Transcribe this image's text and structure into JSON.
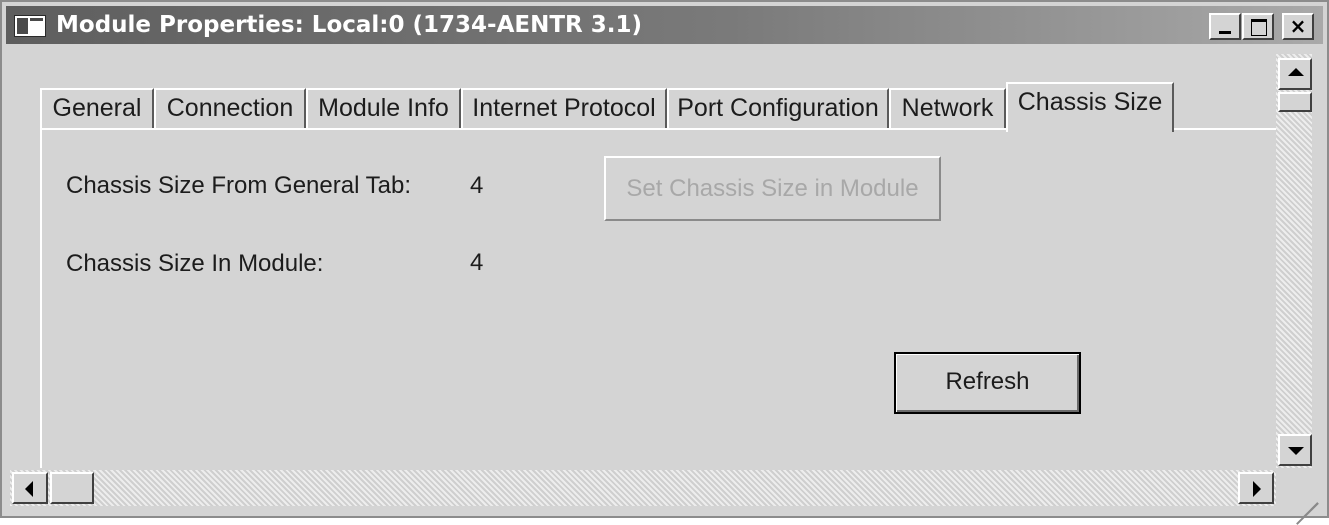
{
  "window": {
    "title": "Module Properties: Local:0 (1734-AENTR 3.1)",
    "controls": {
      "minimize": "minimize",
      "maximize": "maximize",
      "close_label": "×"
    }
  },
  "tabs": [
    {
      "label": "General"
    },
    {
      "label": "Connection"
    },
    {
      "label": "Module Info"
    },
    {
      "label": "Internet Protocol"
    },
    {
      "label": "Port Configuration"
    },
    {
      "label": "Network"
    },
    {
      "label": "Chassis Size",
      "active": true
    }
  ],
  "chassis": {
    "from_general_label": "Chassis Size From General Tab:",
    "from_general_value": "4",
    "in_module_label": "Chassis Size In Module:",
    "in_module_value": "4",
    "set_button_label": "Set Chassis Size in Module",
    "set_button_disabled": true,
    "refresh_label": "Refresh"
  },
  "colors": {
    "face": "#d4d4d4",
    "titlebar_start": "#5e5e5e",
    "titlebar_end": "#a9a9a9",
    "disabled_text": "#a8a8a8"
  },
  "icons": [
    "app-window-icon",
    "minimize-icon",
    "maximize-icon",
    "close-icon",
    "arrow-up-icon",
    "arrow-down-icon",
    "arrow-left-icon",
    "arrow-right-icon",
    "resize-grip-icon"
  ]
}
